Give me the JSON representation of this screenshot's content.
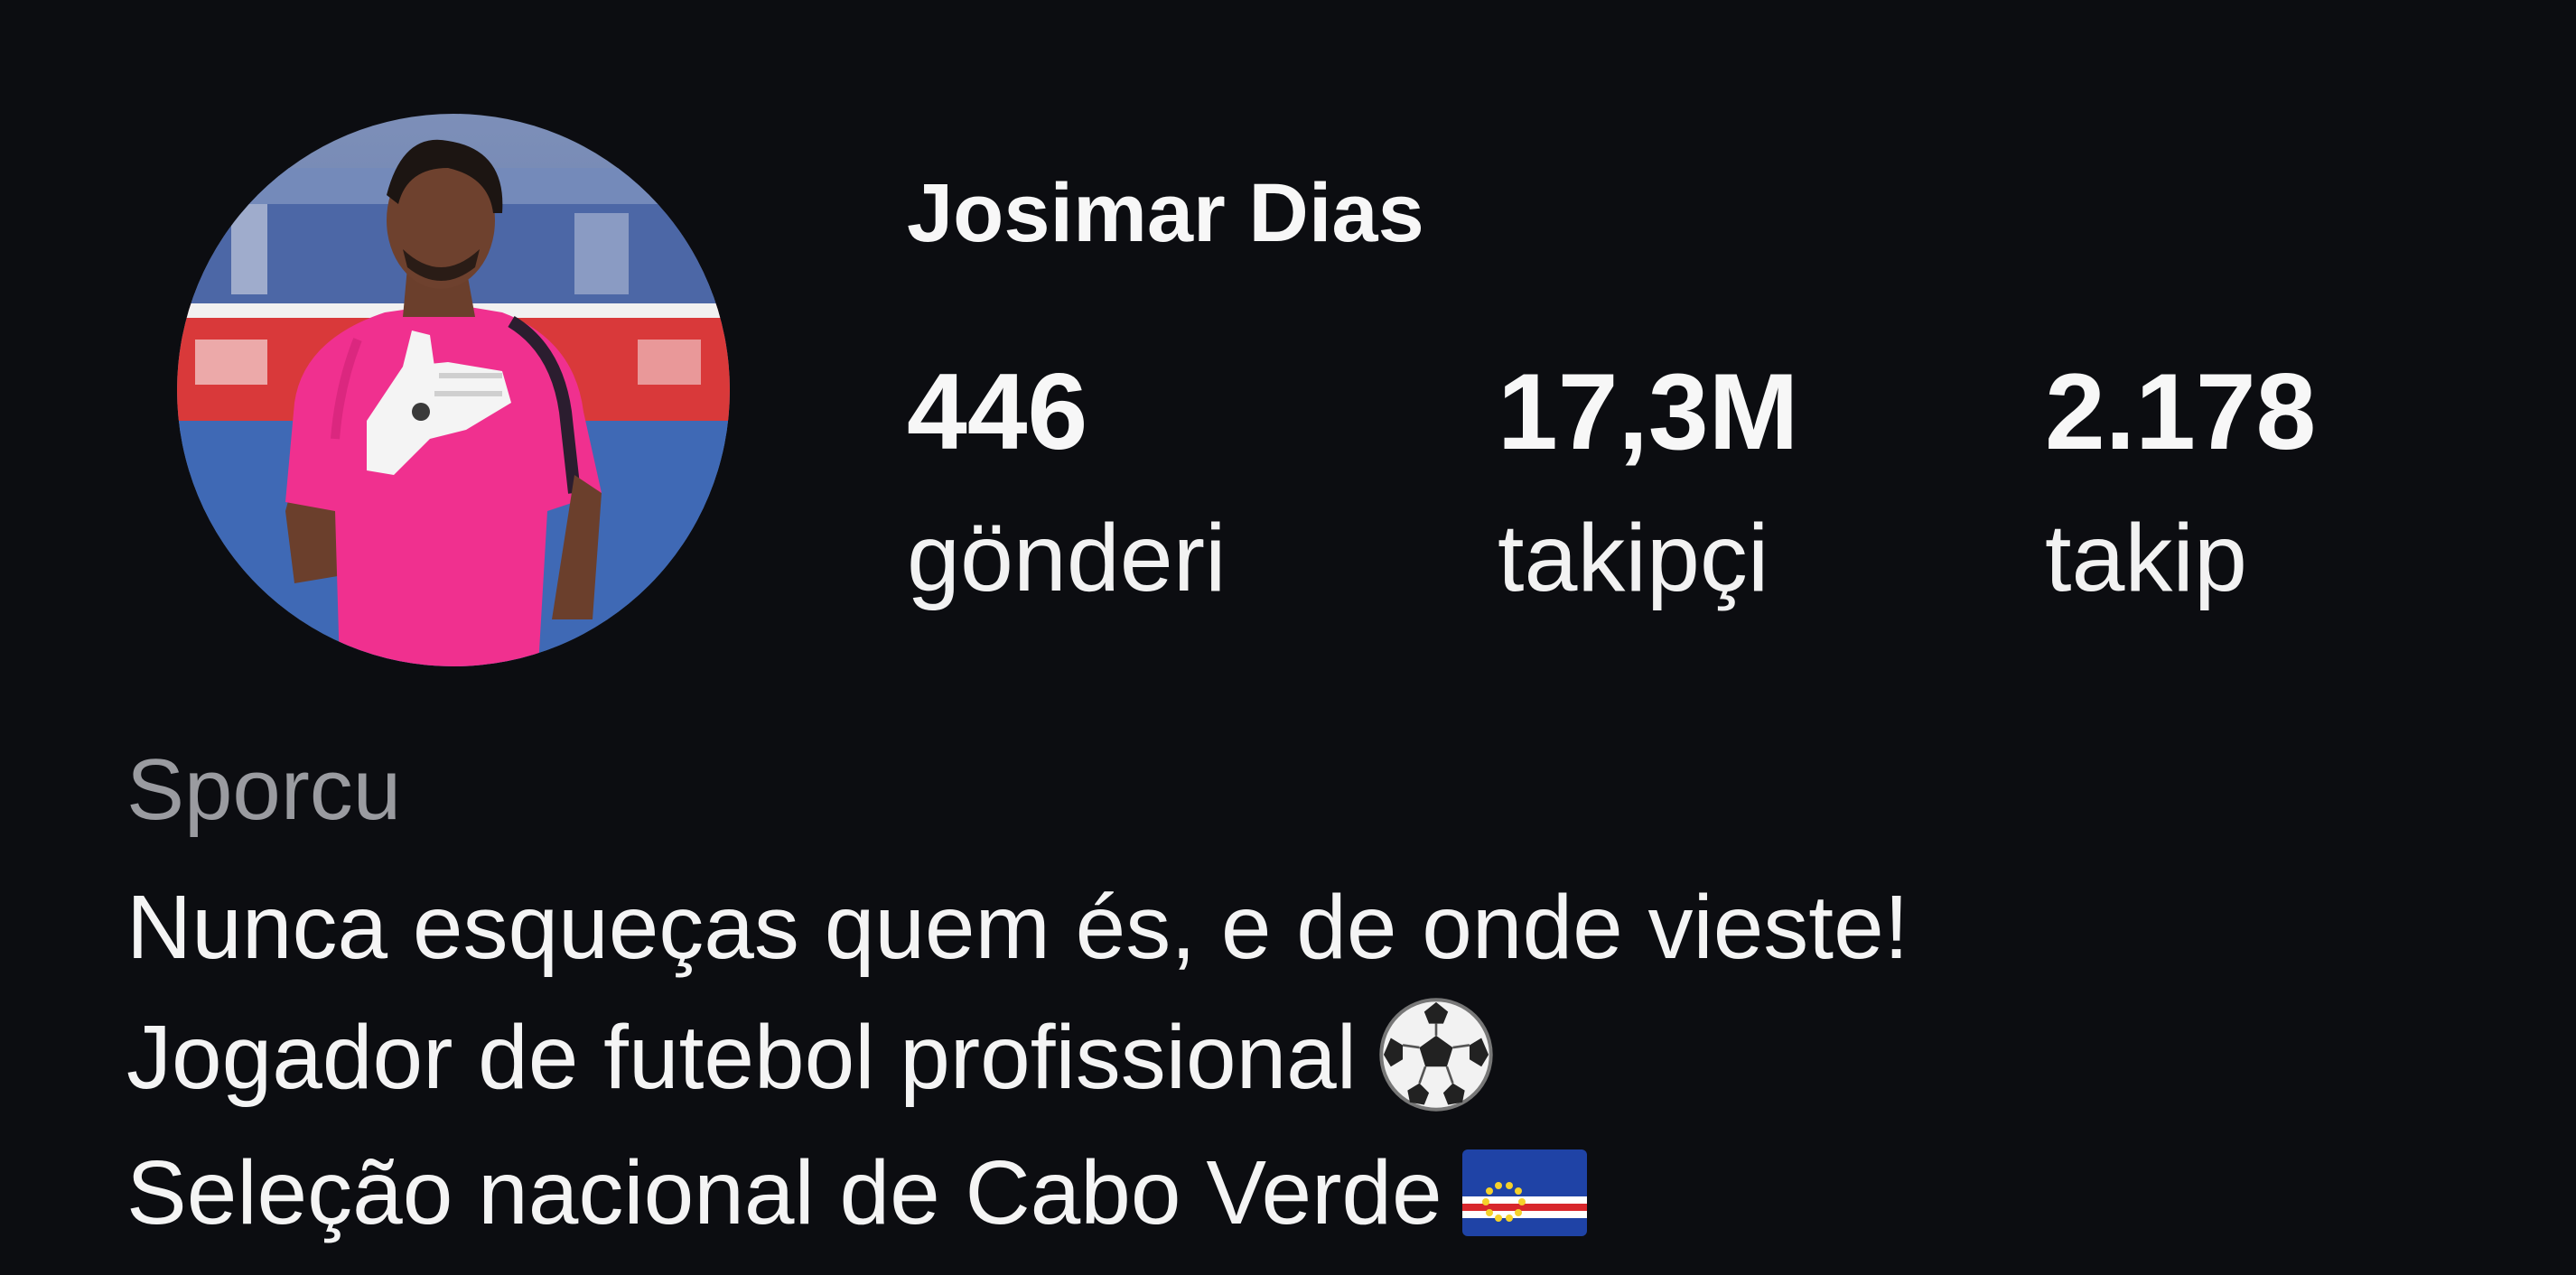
{
  "profile": {
    "username": "Josimar Dias",
    "stats": {
      "posts": {
        "count": "446",
        "label": "gönderi"
      },
      "followers": {
        "count": "17,3M",
        "label": "takipçi"
      },
      "following": {
        "count": "2.178",
        "label": "takip"
      }
    },
    "category": "Sporcu",
    "bio": {
      "line1": "Nunca esqueças quem és, e de onde vieste!",
      "line2": "Jogador de futebol profissional",
      "line2_icon": "soccer-ball-icon",
      "line3": "Seleção nacional de Cabo Verde",
      "line3_icon": "cabo-verde-flag-icon"
    }
  },
  "colors": {
    "background": "#0c0d11",
    "primary_text": "#f5f5f5",
    "secondary_text": "#9a9ba0",
    "jersey": "#f0308f",
    "stadium_blue": "#3a5fa8"
  }
}
